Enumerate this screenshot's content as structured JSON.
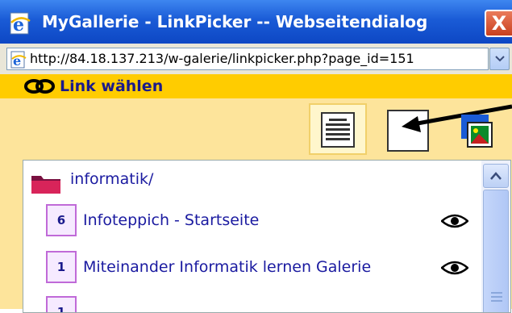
{
  "window": {
    "title": "MyGallerie - LinkPicker -- Webseitendialog",
    "close_label": "X"
  },
  "address": {
    "url": "http://84.18.137.213/w-galerie/linkpicker.php?page_id=151"
  },
  "toolbar": {
    "label": "Link wählen"
  },
  "tree": {
    "folder": "informatik/",
    "pages": [
      {
        "id": "6",
        "title": "Infoteppich - Startseite"
      },
      {
        "id": "1",
        "title": "Miteinander Informatik lernen Galerie"
      },
      {
        "id": "1",
        "title": ""
      }
    ]
  },
  "colors": {
    "titlebar": "#1a5bd6",
    "toolbar": "#ffcc00",
    "link_text": "#1a1aa0",
    "page_badge_border": "#c06ad8"
  },
  "icons": [
    "ie-page-icon",
    "link-icon",
    "list-view-icon",
    "page-view-icon",
    "gallery-view-icon",
    "folder-icon",
    "eye-icon",
    "scroll-up-icon"
  ]
}
